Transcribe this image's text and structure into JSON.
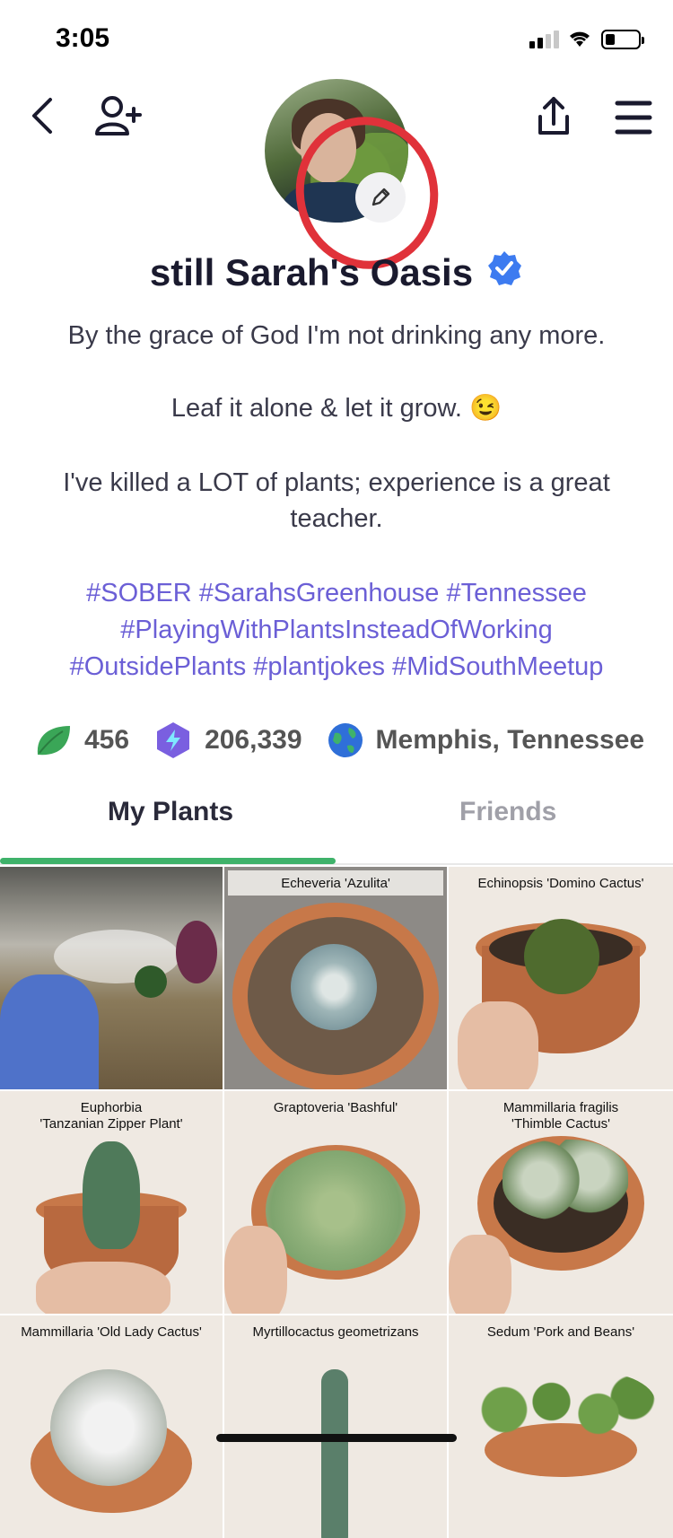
{
  "status_bar": {
    "time": "3:05"
  },
  "profile": {
    "name": "still Sarah's Oasis",
    "bio_lines": [
      "By the grace of God I'm not drinking any more.",
      "Leaf it alone & let it grow. 😉",
      "I've killed a LOT of plants; experience is a great teacher."
    ],
    "hashtag_lines": [
      "#SOBER #SarahsGreenhouse #Tennessee",
      "#PlayingWithPlantsInsteadOfWorking",
      "#OutsidePlants #plantjokes #MidSouthMeetup"
    ],
    "stats": {
      "plants": "456",
      "points": "206,339",
      "location": "Memphis, Tennessee"
    }
  },
  "tabs": [
    {
      "label": "My Plants",
      "active": true
    },
    {
      "label": "Friends",
      "active": false
    }
  ],
  "plants": [
    {
      "caption": ""
    },
    {
      "caption": "Echeveria 'Azulita'"
    },
    {
      "caption": "Echinopsis 'Domino Cactus'"
    },
    {
      "caption": "Euphorbia\n'Tanzanian Zipper Plant'"
    },
    {
      "caption": "Graptoveria 'Bashful'"
    },
    {
      "caption": "Mammillaria fragilis\n'Thimble Cactus'"
    },
    {
      "caption": "Mammillaria 'Old Lady Cactus'"
    },
    {
      "caption": "Myrtillocactus geometrizans"
    },
    {
      "caption": "Sedum 'Pork and Beans'"
    }
  ],
  "colors": {
    "accent": "#3fb26a",
    "hashtag": "#6b5fd6",
    "annotation": "#e0323a",
    "verified": "#3d7bf0"
  },
  "icons": [
    "back-chevron-icon",
    "add-friend-icon",
    "share-icon",
    "menu-icon",
    "pencil-icon",
    "verified-badge-icon",
    "leaf-icon",
    "lightning-hexagon-icon",
    "globe-icon"
  ]
}
